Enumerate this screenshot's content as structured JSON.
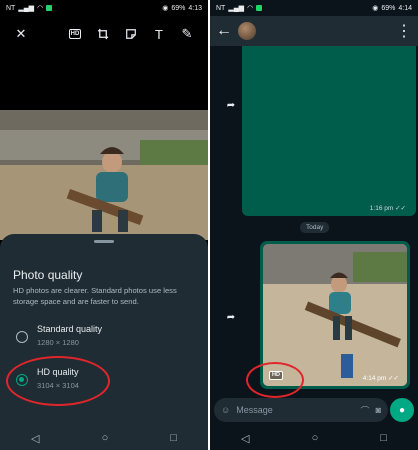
{
  "left_screen": {
    "status": {
      "carrier": "NT",
      "battery": "69%",
      "time": "4:13"
    },
    "toolbar": {
      "close_icon": "close-icon",
      "hd_label": "HD",
      "crop_icon": "crop-icon",
      "sticker_icon": "sticker-icon",
      "text_label": "T",
      "pencil_icon": "pencil-icon"
    },
    "sheet": {
      "title": "Photo quality",
      "description": "HD photos are clearer. Standard photos use less storage space and are faster to send.",
      "options": [
        {
          "label": "Standard quality",
          "resolution": "1280 × 1280",
          "selected": false
        },
        {
          "label": "HD quality",
          "resolution": "3104 × 3104",
          "selected": true
        }
      ]
    }
  },
  "right_screen": {
    "status": {
      "carrier": "NT",
      "battery": "69%",
      "time": "4:14"
    },
    "messages": [
      {
        "type": "image",
        "time": "1:16 pm"
      },
      {
        "type": "date",
        "label": "Today"
      },
      {
        "type": "image",
        "time": "4:14 pm",
        "badge": "HD"
      }
    ],
    "composer": {
      "placeholder": "Message"
    }
  },
  "colors": {
    "accent": "#00a884",
    "bubble": "#005c4b",
    "sheet_bg": "#1f2c34",
    "annotation_red": "#e0262b"
  }
}
